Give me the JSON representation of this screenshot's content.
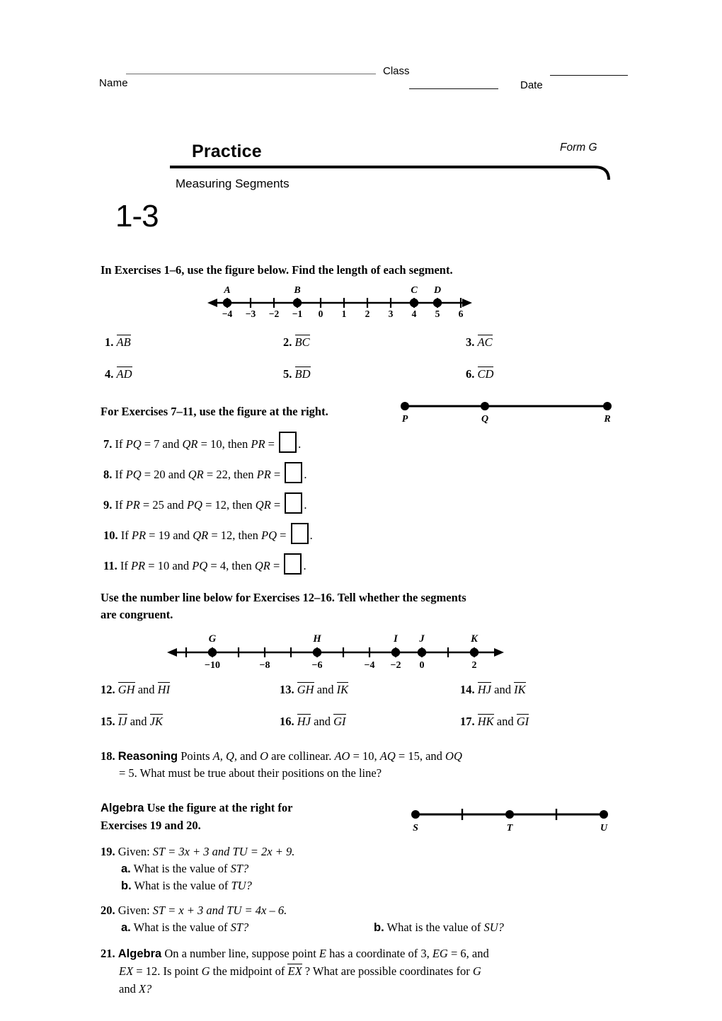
{
  "header": {
    "name_label": "Name",
    "class_label": "Class",
    "date_label": "Date"
  },
  "title": {
    "practice": "Practice",
    "form": "Form G",
    "subtitle": "Measuring Segments",
    "lesson": "1-3"
  },
  "directions": {
    "d1": "In Exercises 1–6, use the figure below. Find the length of each segment.",
    "d2": "For Exercises 7–11, use the figure at the right.",
    "d3_line1": "Use the number line below for Exercises 12–16. Tell whether the segments",
    "d3_line2": "are congruent.",
    "algebra_label": "Algebra",
    "algebra_rest_line1": "Use the figure at the right for",
    "algebra_rest_line2": "Exercises 19 and 20."
  },
  "figure1": {
    "name": "number-line-ABCD",
    "ticks": [
      "−4",
      "−3",
      "−2",
      "−1",
      "0",
      "1",
      "2",
      "3",
      "4",
      "5",
      "6"
    ],
    "points": [
      {
        "label": "A",
        "coord": -4
      },
      {
        "label": "B",
        "coord": -1
      },
      {
        "label": "C",
        "coord": 4
      },
      {
        "label": "D",
        "coord": 5
      }
    ]
  },
  "figure2": {
    "name": "segment-PQR",
    "points": [
      "P",
      "Q",
      "R"
    ]
  },
  "figure3": {
    "name": "number-line-GHIJK",
    "ticks": [
      "−10",
      "−8",
      "−6",
      "−4",
      "−2",
      "0",
      "2"
    ],
    "points": [
      {
        "label": "G",
        "coord": -10
      },
      {
        "label": "H",
        "coord": -6
      },
      {
        "label": "I",
        "coord": -2
      },
      {
        "label": "J",
        "coord": 0
      },
      {
        "label": "K",
        "coord": 2
      }
    ]
  },
  "figure4": {
    "name": "segment-STU",
    "points": [
      "S",
      "T",
      "U"
    ]
  },
  "exercises_1_6": [
    {
      "n": "1.",
      "seg": "AB"
    },
    {
      "n": "2.",
      "seg": "BC"
    },
    {
      "n": "3.",
      "seg": "AC"
    },
    {
      "n": "4.",
      "seg": "AD"
    },
    {
      "n": "5.",
      "seg": "BD"
    },
    {
      "n": "6.",
      "seg": "CD"
    }
  ],
  "exercises_7_11": [
    {
      "n": "7.",
      "pre": "If ",
      "v1": "PQ",
      "e1": " = 7 and ",
      "v2": "QR",
      "e2": " = 10, then ",
      "v3": "PR",
      "e3": " = ",
      "post": "."
    },
    {
      "n": "8.",
      "pre": "If ",
      "v1": "PQ",
      "e1": " = 20 and ",
      "v2": "QR",
      "e2": " = 22, then ",
      "v3": "PR",
      "e3": " = ",
      "post": "."
    },
    {
      "n": "9.",
      "pre": "If ",
      "v1": "PR",
      "e1": " = 25 and ",
      "v2": "PQ",
      "e2": " = 12, then ",
      "v3": "QR",
      "e3": " = ",
      "post": "."
    },
    {
      "n": "10.",
      "pre": "If ",
      "v1": "PR",
      "e1": " = 19 and ",
      "v2": "QR",
      "e2": " = 12, then ",
      "v3": "PQ",
      "e3": " = ",
      "post": "."
    },
    {
      "n": "11.",
      "pre": "If ",
      "v1": "PR",
      "e1": " = 10 and ",
      "v2": "PQ",
      "e2": " = 4, then ",
      "v3": "QR",
      "e3": " = ",
      "post": "."
    }
  ],
  "exercises_12_17": [
    {
      "n": "12.",
      "a": "GH",
      "and": "and",
      "b": "HI"
    },
    {
      "n": "13.",
      "a": "GH",
      "and": "and",
      "b": "IK"
    },
    {
      "n": "14.",
      "a": "HJ",
      "and": "and",
      "b": "IK"
    },
    {
      "n": "15.",
      "a": "IJ",
      "and": "and",
      "b": "JK"
    },
    {
      "n": "16.",
      "a": "HJ",
      "and": "and",
      "b": "GI"
    },
    {
      "n": "17.",
      "a": "HK",
      "and": "and",
      "b": "GI"
    }
  ],
  "exercise18": {
    "n": "18.",
    "label": "Reasoning",
    "l1_a": " Points ",
    "l1_vars": "A, Q,",
    "l1_b": " and ",
    "l1_c": "O",
    "l1_d": " are collinear. ",
    "l1_e": "AO",
    "l1_f": " = 10, ",
    "l1_g": "AQ",
    "l1_h": " = 15, and ",
    "l1_i": "OQ",
    "l2": "= 5. What must be true about their positions on the line?"
  },
  "exercise19": {
    "n": "19.",
    "given_pre": "Given: ",
    "v1": "ST",
    "mid": " = 3x + 3 and ",
    "v2": "TU",
    "end": " = 2x + 9.",
    "a_label": "a.",
    "a_text_pre": " What is the value of ",
    "a_var": "ST?",
    "b_label": "b.",
    "b_text_pre": " What is the value of ",
    "b_var": "TU?"
  },
  "exercise20": {
    "n": "20.",
    "given_pre": "Given: ",
    "v1": "ST",
    "mid": " = x + 3 and ",
    "v2": "TU",
    "end": " = 4x – 6.",
    "a_label": "a.",
    "a_text_pre": " What is the value of ",
    "a_var": "ST?",
    "b_label": "b.",
    "b_text_pre": " What is the value of ",
    "b_var": "SU?"
  },
  "exercise21": {
    "n": "21.",
    "label": "Algebra",
    "l1_a": " On a number line, suppose point ",
    "l1_E": "E",
    "l1_b": " has a coordinate of 3, ",
    "l1_EG": "EG",
    "l1_c": " = 6, and",
    "l2_EX": "EX",
    "l2_a": " = 12. Is point ",
    "l2_G": "G",
    "l2_b": " the midpoint of ",
    "l2_seg": "EX",
    "l2_c": " ? What are possible coordinates for ",
    "l2_G2": "G",
    "l3_a": "and ",
    "l3_X": "X?"
  },
  "colors": {
    "ink": "#000000",
    "rule_gray": "#6e6e6e"
  }
}
